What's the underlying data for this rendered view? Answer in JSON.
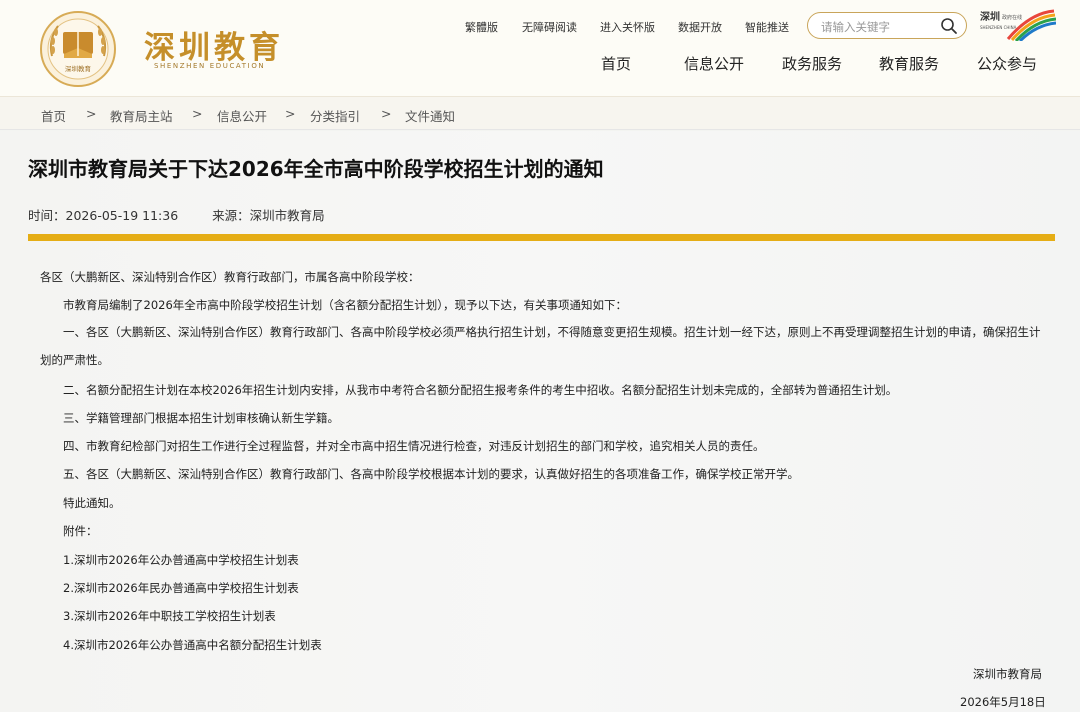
{
  "header": {
    "logo_text": "深圳教育",
    "logo_sub": "SHENZHEN EDUCATION",
    "seal_text": "深圳教育",
    "utility_links": [
      "繁體版",
      "无障碍阅读",
      "进入关怀版",
      "数据开放",
      "智能推送"
    ],
    "search": {
      "placeholder": "请输入关键字"
    },
    "partner_logo": {
      "text1": "深圳",
      "text2": "政府在线",
      "text3": "SHENZHEN CHINA"
    },
    "nav": [
      "首页",
      "信息公开",
      "政务服务",
      "教育服务",
      "公众参与"
    ]
  },
  "breadcrumb": [
    "首页",
    "教育局主站",
    "信息公开",
    "分类指引",
    "文件通知"
  ],
  "breadcrumb_sep": ">",
  "article": {
    "title": "深圳市教育局关于下达2026年全市高中阶段学校招生计划的通知",
    "time_label": "时间：",
    "time": "2026-05-19 11:36",
    "source_label": "来源：",
    "source": "深圳市教育局",
    "salutation": "各区（大鹏新区、深汕特别合作区）教育行政部门，市属各高中阶段学校：",
    "intro": "市教育局编制了2026年全市高中阶段学校招生计划（含名额分配招生计划），现予以下达，有关事项通知如下：",
    "items": [
      "一、各区（大鹏新区、深汕特别合作区）教育行政部门、各高中阶段学校必须严格执行招生计划，不得随意变更招生规模。招生计划一经下达，原则上不再受理调整招生计划的申请，确保招生计划的严肃性。",
      "二、名额分配招生计划在本校2026年招生计划内安排，从我市中考符合名额分配招生报考条件的考生中招收。名额分配招生计划未完成的，全部转为普通招生计划。",
      "三、学籍管理部门根据本招生计划审核确认新生学籍。",
      "四、市教育纪检部门对招生工作进行全过程监督，并对全市高中招生情况进行检查，对违反计划招生的部门和学校，追究相关人员的责任。",
      "五、各区（大鹏新区、深汕特别合作区）教育行政部门、各高中阶段学校根据本计划的要求，认真做好招生的各项准备工作，确保学校正常开学。"
    ],
    "closing": "特此通知。",
    "attachments_label": "附件：",
    "attachments": [
      "1.深圳市2026年公办普通高中学校招生计划表",
      "2.深圳市2026年民办普通高中学校招生计划表",
      "3.深圳市2026年中职技工学校招生计划表",
      "4.深圳市2026年公办普通高中名额分配招生计划表"
    ],
    "signature": "深圳市教育局",
    "date": "2026年5月18日"
  },
  "colors": {
    "accent": "#e5ad15",
    "brand_gold": "#c58f2a"
  }
}
